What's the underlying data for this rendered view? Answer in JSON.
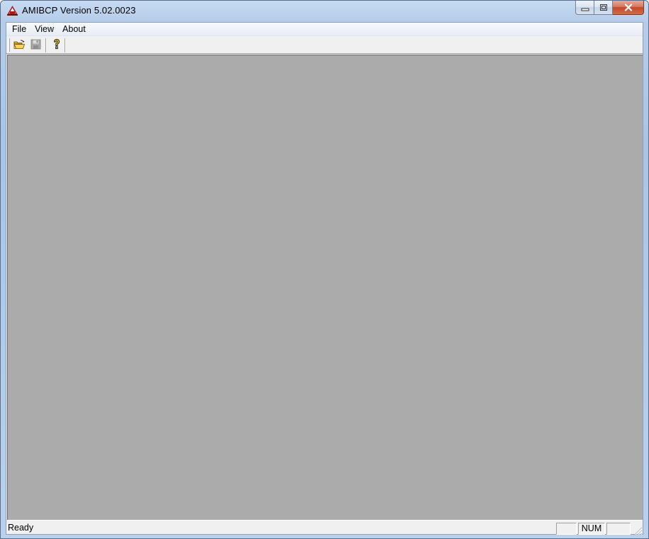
{
  "window": {
    "title": "AMIBCP Version 5.02.0023",
    "app_icon": "amibcp-logo-icon",
    "caption_buttons": [
      "minimize-icon",
      "restore-icon",
      "close-icon"
    ]
  },
  "menubar": {
    "items": [
      {
        "label": "File"
      },
      {
        "label": "View"
      },
      {
        "label": "About"
      }
    ]
  },
  "toolbar": {
    "buttons": [
      {
        "icon": "open-folder-icon",
        "enabled": true
      },
      {
        "icon": "save-disk-icon",
        "enabled": false
      },
      {
        "icon": "help-question-icon",
        "enabled": true
      }
    ]
  },
  "statusbar": {
    "message": "Ready",
    "panes": [
      "",
      "NUM",
      ""
    ]
  },
  "colors": {
    "workspace": "#ababab",
    "chrome": "#f0f0f0",
    "close_button": "#c44a2c"
  }
}
